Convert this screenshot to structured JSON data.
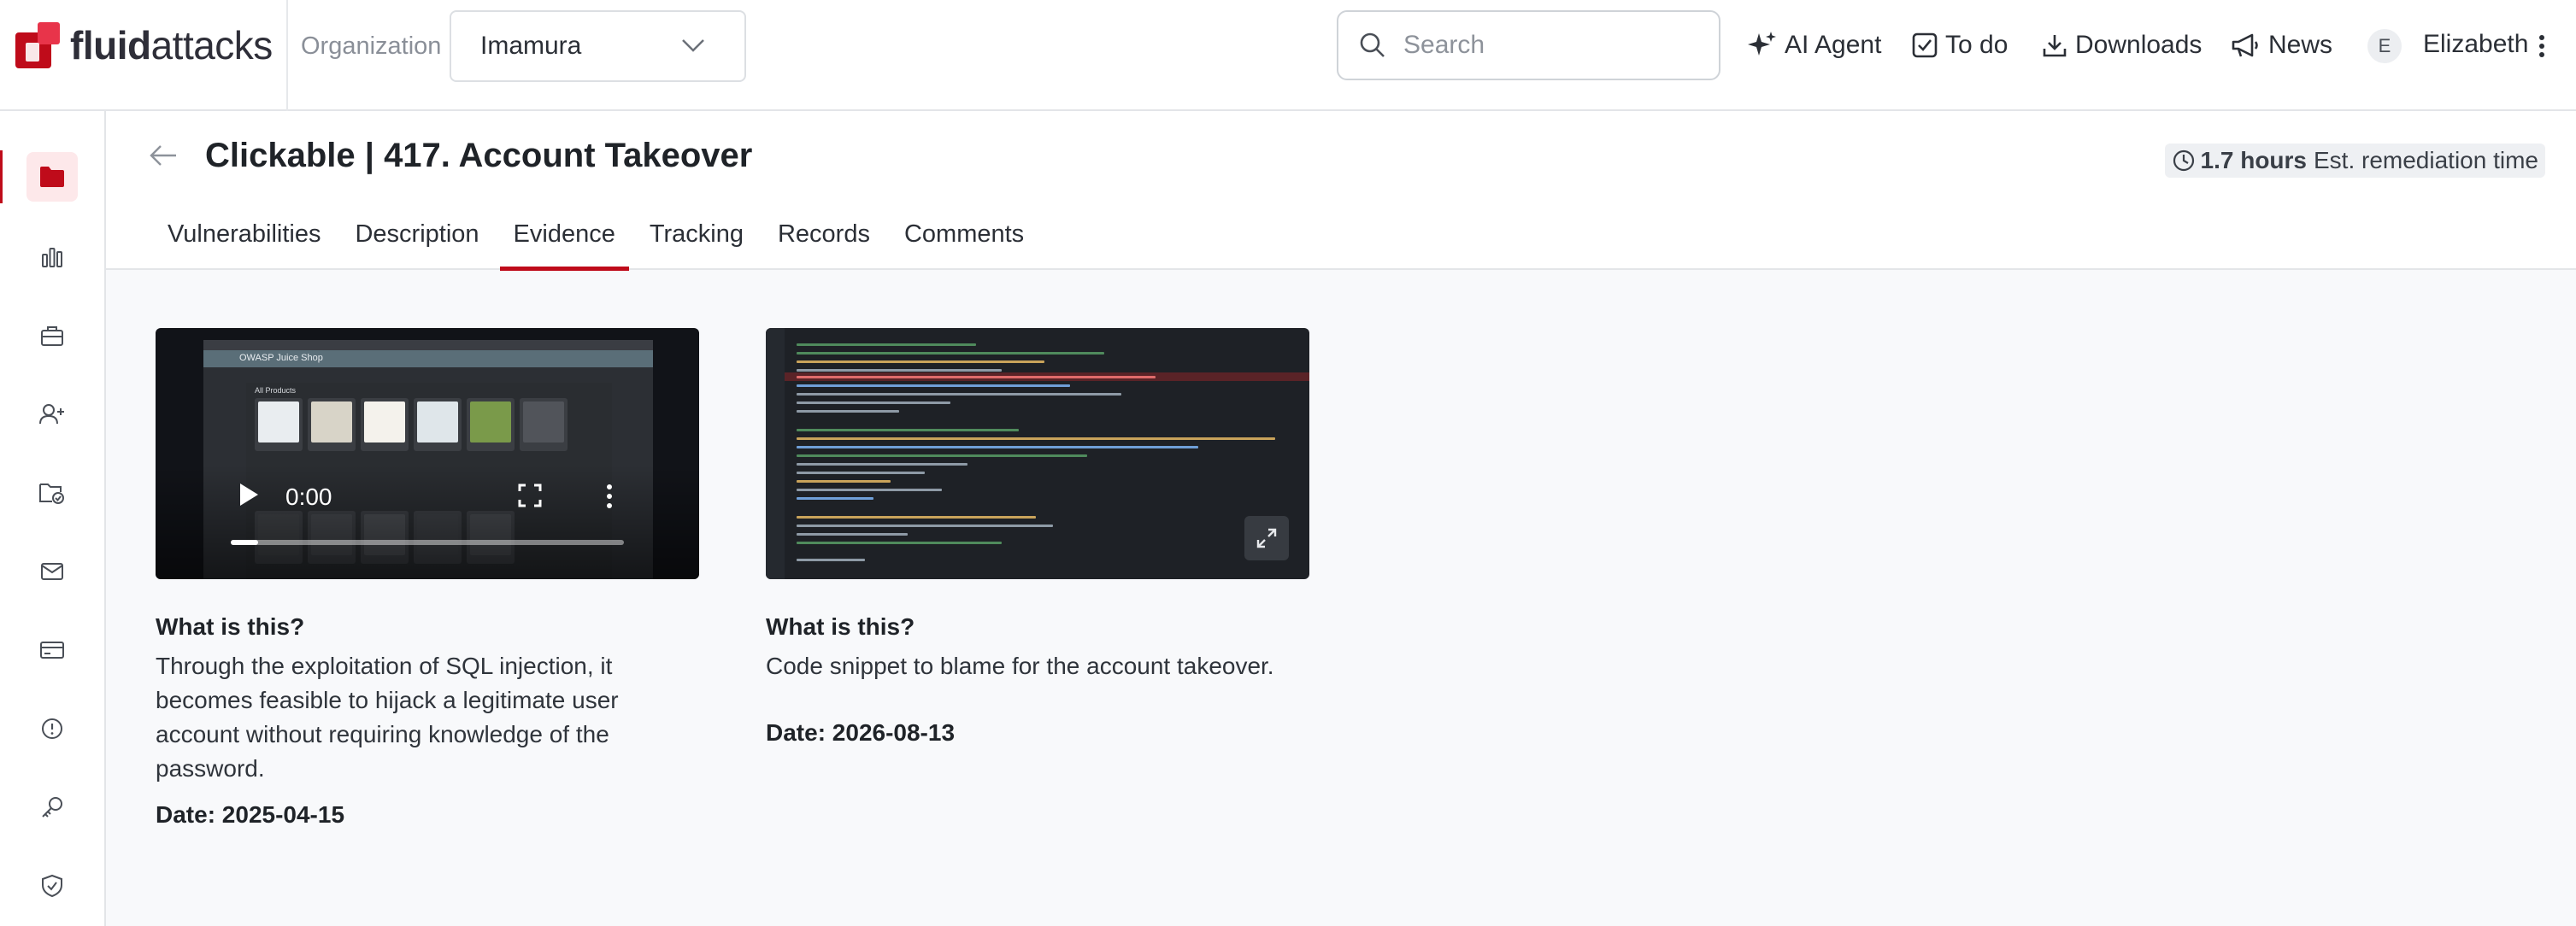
{
  "brand": {
    "name_bold": "fluid",
    "name_rest": "attacks"
  },
  "org": {
    "label": "Organization",
    "selected": "Imamura"
  },
  "search": {
    "placeholder": "Search"
  },
  "nav": {
    "ai_agent": "AI Agent",
    "todo": "To do",
    "downloads": "Downloads",
    "news": "News",
    "user_initial": "E",
    "user_name": "Elizabeth"
  },
  "sidebar": {
    "items": [
      "folder-icon",
      "bar-chart-icon",
      "briefcase-icon",
      "add-user-icon",
      "folder-check-icon",
      "mail-icon",
      "credit-card-icon",
      "alert-circle-icon",
      "key-icon",
      "shield-check-icon"
    ],
    "active_index": 0
  },
  "header": {
    "title": "Clickable | 417. Account Takeover",
    "remediation_value": "1.7 hours",
    "remediation_label": "Est. remediation time"
  },
  "tabs": [
    "Vulnerabilities",
    "Description",
    "Evidence",
    "Tracking",
    "Records",
    "Comments"
  ],
  "active_tab": "Evidence",
  "video_app": {
    "shop_name": "OWASP Juice Shop",
    "section": "All Products"
  },
  "evidence": [
    {
      "type": "video",
      "time": "0:00",
      "question": "What is this?",
      "description": "Through the exploitation of SQL injection, it becomes feasible to hijack a legitimate user account without requiring knowledge of the password.",
      "date": "Date: 2025-04-15"
    },
    {
      "type": "image",
      "question": "What is this?",
      "description": "Code snippet to blame for the account takeover.",
      "date": "Date: 2026-08-13"
    }
  ],
  "colors": {
    "accent": "#bf0b1a",
    "accent_bg": "#fde8ea",
    "text": "#1f2328",
    "muted": "#8a8f98"
  }
}
